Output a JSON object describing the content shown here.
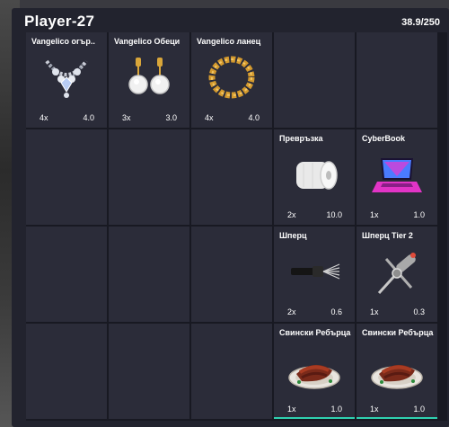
{
  "inventory": {
    "title": "Player-27",
    "weight_text": "38.9/250"
  },
  "slots": [
    {
      "name": "Vangelico огър..",
      "qty": "4x",
      "weight": "4.0",
      "icon": "diamond-necklace-icon"
    },
    {
      "name": "Vangelico Обеци",
      "qty": "3x",
      "weight": "3.0",
      "icon": "diamond-earrings-icon"
    },
    {
      "name": "Vangelico ланец",
      "qty": "4x",
      "weight": "4.0",
      "icon": "gold-chain-icon"
    },
    {
      "name": "Превръзка",
      "qty": "2x",
      "weight": "10.0",
      "icon": "bandage-roll-icon"
    },
    {
      "name": "CyberBook",
      "qty": "1x",
      "weight": "1.0",
      "icon": "laptop-icon"
    },
    {
      "name": "Шперц",
      "qty": "2x",
      "weight": "0.6",
      "icon": "lockpick-icon"
    },
    {
      "name": "Шперц Tier 2",
      "qty": "1x",
      "weight": "0.3",
      "icon": "advanced-lockpick-icon"
    },
    {
      "name": "Свински Ребърца",
      "qty": "1x",
      "weight": "1.0",
      "icon": "pork-ribs-icon"
    },
    {
      "name": "Свински Ребърца",
      "qty": "1x",
      "weight": "1.0",
      "icon": "pork-ribs-icon"
    }
  ]
}
